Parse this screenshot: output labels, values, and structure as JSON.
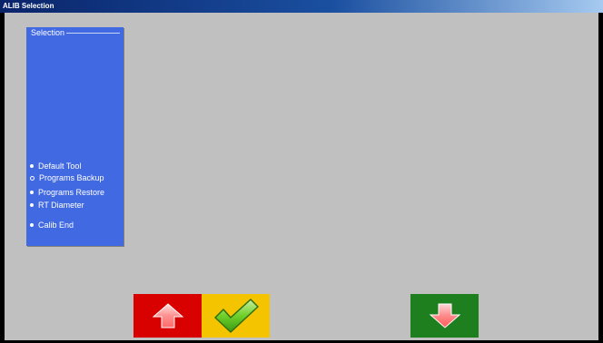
{
  "window": {
    "title": "ALIB Selection"
  },
  "selection": {
    "title": "Selection",
    "options": [
      {
        "label": "Default Tool",
        "selected": false
      },
      {
        "label": "Programs Backup",
        "selected": true
      },
      {
        "label": "Programs Restore",
        "selected": false
      },
      {
        "label": "RT Diameter",
        "selected": false
      },
      {
        "label": "Calib End",
        "selected": false
      }
    ]
  },
  "buttons": {
    "up": {
      "icon": "arrow-up-icon",
      "color": "#d90000"
    },
    "confirm": {
      "icon": "checkmark-icon",
      "color": "#f5c400"
    },
    "down": {
      "icon": "arrow-down-icon",
      "color": "#1e7f1e"
    }
  }
}
